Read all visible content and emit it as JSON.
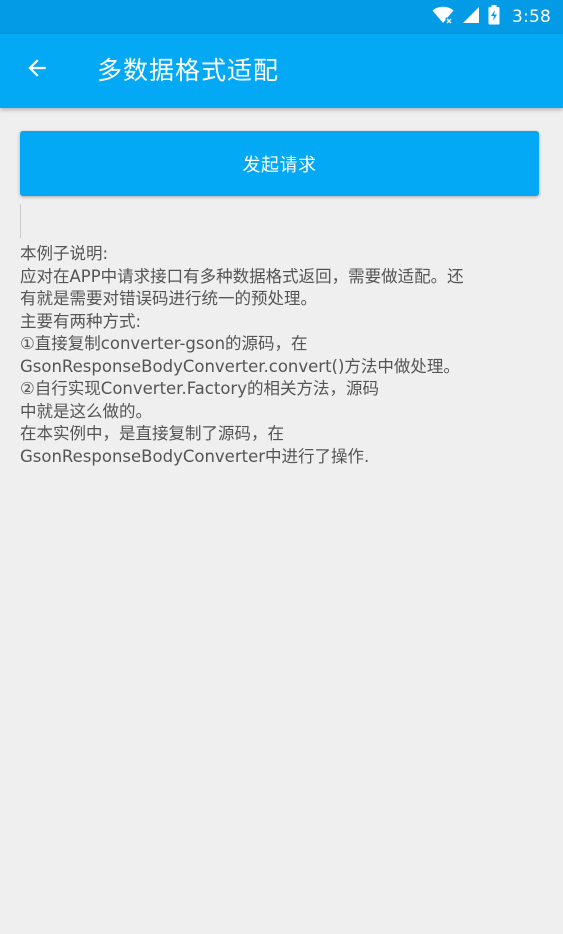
{
  "status_bar": {
    "time": "3:58",
    "icons": [
      "wifi-icon",
      "signal-icon",
      "battery-icon"
    ]
  },
  "app_bar": {
    "back_icon": "arrow-left-icon",
    "title": "多数据格式适配"
  },
  "main": {
    "request_button_label": "发起请求",
    "description_lines": [
      "本例子说明:",
      "应对在APP中请求接口有多种数据格式返回，需要做适配。还",
      "有就是需要对错误码进行统一的预处理。",
      "主要有两种方式:",
      "①直接复制converter-gson的源码，在",
      "GsonResponseBodyConverter.convert()方法中做处理。",
      "②自行实现Converter.Factory的相关方法，源码",
      "中就是这么做的。",
      "在本实例中，是直接复制了源码，在",
      "GsonResponseBodyConverter中进行了操作."
    ]
  },
  "colors": {
    "primary": "#03a9f4",
    "primary_dark": "#039be5",
    "background": "#efefef",
    "text": "#555555"
  }
}
